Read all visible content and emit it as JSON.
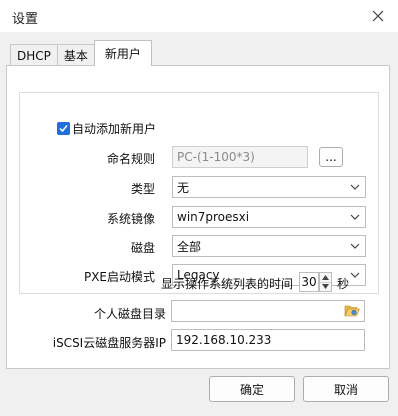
{
  "window": {
    "title": "设置",
    "close_icon": "close-icon"
  },
  "tabs": [
    {
      "label": "DHCP"
    },
    {
      "label": "基本"
    },
    {
      "label": "新用户"
    }
  ],
  "active_tab": "新用户",
  "new_user": {
    "auto_add": {
      "label": "自动添加新用户",
      "checked": true
    },
    "naming_rule": {
      "label": "命名规则",
      "value": "PC-(1-100*3)",
      "browse_label": "..."
    },
    "type": {
      "label": "类型",
      "value": "无"
    },
    "system_image": {
      "label": "系统镜像",
      "value": "win7proesxi"
    },
    "disk": {
      "label": "磁盘",
      "value": "全部"
    },
    "pxe_mode": {
      "label": "PXE启动模式",
      "value": "Legacy"
    }
  },
  "os_list_time": {
    "label": "显示操作系统列表的时间",
    "value": "30",
    "unit": "秒"
  },
  "personal_disk_dir": {
    "label": "个人磁盘目录",
    "value": "",
    "icon": "folder-open-icon"
  },
  "iscsi_server_ip": {
    "label": "iSCSI云磁盘服务器IP",
    "value": "192.168.10.233"
  },
  "buttons": {
    "ok": "确定",
    "cancel": "取消"
  },
  "colors": {
    "accent": "#1e6fd9",
    "panel_bg": "#f0f0f0"
  }
}
